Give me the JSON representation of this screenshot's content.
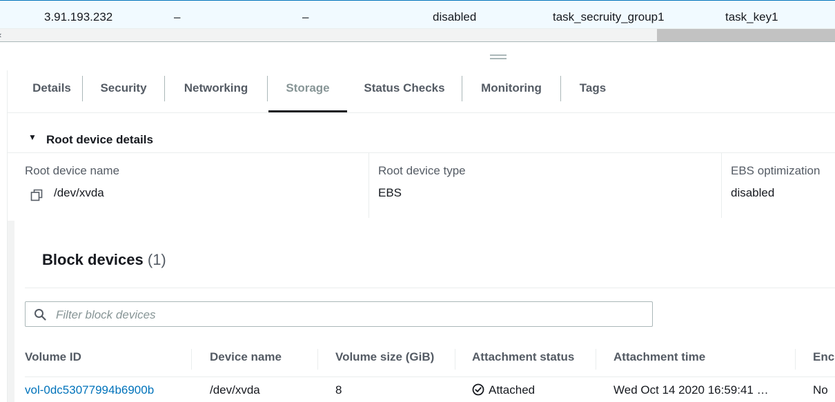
{
  "instance_row": {
    "public_ip": "3.91.193.232",
    "col2": "–",
    "col3": "–",
    "monitoring": "disabled",
    "security_group": "task_secruity_group1",
    "key_name": "task_key1"
  },
  "tabs": [
    {
      "label": "Details"
    },
    {
      "label": "Security"
    },
    {
      "label": "Networking"
    },
    {
      "label": "Storage"
    },
    {
      "label": "Status Checks"
    },
    {
      "label": "Monitoring"
    },
    {
      "label": "Tags"
    }
  ],
  "active_tab": "Storage",
  "root_device": {
    "section_title": "Root device details",
    "name_label": "Root device name",
    "name_value": "/dev/xvda",
    "type_label": "Root device type",
    "type_value": "EBS",
    "ebs_label": "EBS optimization",
    "ebs_value": "disabled"
  },
  "block_devices": {
    "title": "Block devices",
    "count": "(1)",
    "filter_placeholder": "Filter block devices",
    "columns": [
      "Volume ID",
      "Device name",
      "Volume size (GiB)",
      "Attachment status",
      "Attachment time",
      "Encr"
    ],
    "rows": [
      {
        "volume_id": "vol-0dc53077994b6900b",
        "device_name": "/dev/xvda",
        "size": "8",
        "status": "Attached",
        "time": "Wed Oct 14 2020 16:59:41 …",
        "encrypted": "No"
      }
    ]
  },
  "icons": {
    "copy": "copy-icon",
    "search": "search-icon",
    "status": "check-circle-icon",
    "caret": "caret-down-icon"
  },
  "colors": {
    "link": "#0073bb",
    "selected_row_bg": "#f1faff",
    "panel_bg": "#f2f3f3"
  }
}
